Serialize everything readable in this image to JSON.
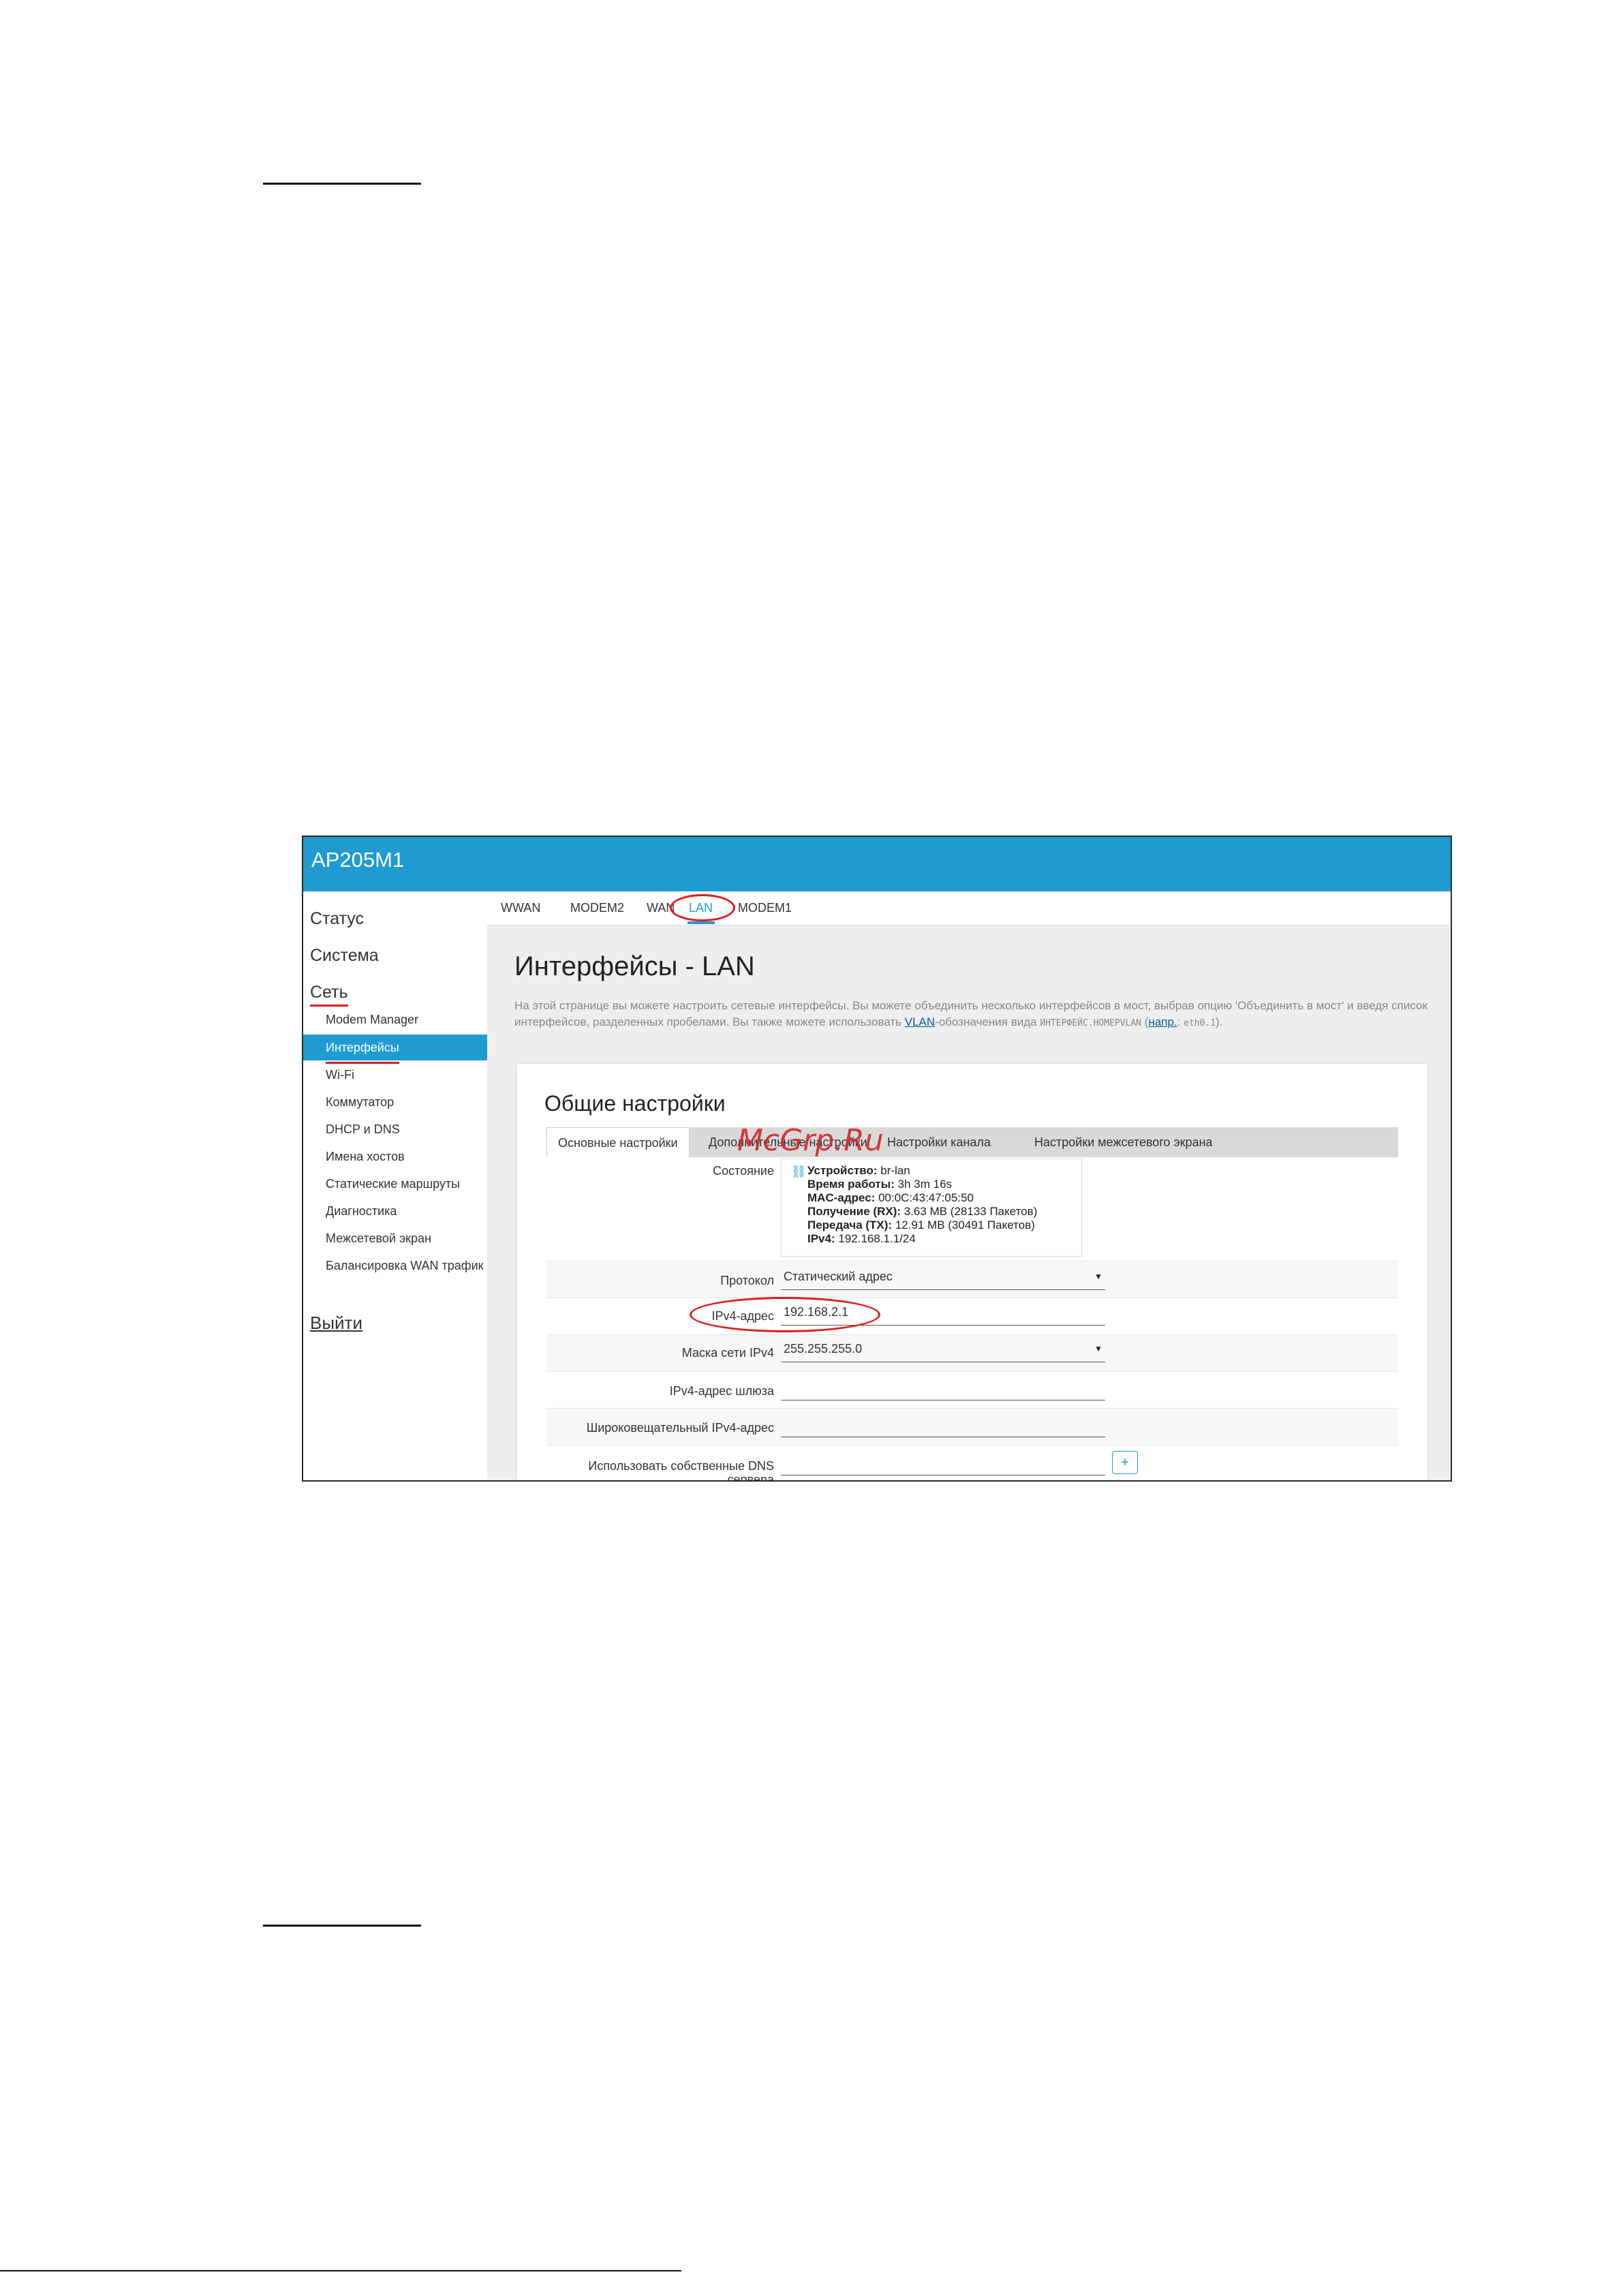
{
  "app": {
    "title": "AP205M1"
  },
  "sidebar": {
    "top_items": [
      {
        "label": "Статус"
      },
      {
        "label": "Система"
      },
      {
        "label": "Сеть"
      }
    ],
    "sub_items": [
      {
        "label": "Modem Manager"
      },
      {
        "label": "Интерфейсы"
      },
      {
        "label": "Wi-Fi"
      },
      {
        "label": "Коммутатор"
      },
      {
        "label": "DHCP и DNS"
      },
      {
        "label": "Имена хостов"
      },
      {
        "label": "Статические маршруты"
      },
      {
        "label": "Диагностика"
      },
      {
        "label": "Межсетевой экран"
      },
      {
        "label": "Балансировка WAN трафик"
      }
    ],
    "logout_label": "Выйти"
  },
  "interface_tabs": [
    {
      "label": "WWAN"
    },
    {
      "label": "MODEM2"
    },
    {
      "label": "WAN"
    },
    {
      "label": "LAN"
    },
    {
      "label": "MODEM1"
    }
  ],
  "main": {
    "title": "Интерфейсы - LAN",
    "desc_part1": "На этой странице вы можете настроить сетевые интерфейсы. Вы можете объединить несколько интерфейсов в мост, выбрав опцию 'Объединить в мост' и введя список интерфейсов, разделенных пробелами. Вы также можете использовать ",
    "desc_vlan": "VLAN",
    "desc_part2": "-обозначения вида ",
    "desc_code1": "ИНТЕРФЕЙС.НОМЕРVLAN",
    "desc_part3": " (",
    "desc_example": "напр.",
    "desc_part4": ": ",
    "desc_code2": "eth0.1",
    "desc_part5": ")."
  },
  "card": {
    "title": "Общие настройки",
    "tabs": [
      {
        "label": "Основные настройки"
      },
      {
        "label": "Дополнительные настройки"
      },
      {
        "label": "Настройки канала"
      },
      {
        "label": "Настройки межсетевого экрана"
      }
    ],
    "status_label": "Состояние",
    "status": {
      "device_key": "Устройство:",
      "device_val": " br-lan",
      "uptime_key": "Время работы:",
      "uptime_val": " 3h 3m 16s",
      "mac_key": "MAC-адрес:",
      "mac_val": " 00:0C:43:47:05:50",
      "rx_key": "Получение (RX):",
      "rx_val": " 3.63 MB (28133 Пакетов)",
      "tx_key": "Передача (TX):",
      "tx_val": " 12.91 MB (30491 Пакетов)",
      "ipv4_key": "IPv4:",
      "ipv4_val": " 192.168.1.1/24"
    },
    "fields": {
      "protocol_label": "Протокол",
      "protocol_value": "Статический адрес",
      "ipv4_label": "IPv4-адрес",
      "ipv4_value": "192.168.2.1",
      "mask_label": "Маска сети IPv4",
      "mask_value": "255.255.255.0",
      "gateway_label": "IPv4-адрес шлюза",
      "gateway_value": "",
      "broadcast_label": "Широковещательный IPv4-адрес",
      "broadcast_value": "",
      "dns_label": "Использовать собственные DNS сервера",
      "dns_value": ""
    },
    "plus_label": "+"
  },
  "watermark": "McGrp.Ru",
  "accent_color": "#1f9bd1",
  "highlight_color": "#e01b1b"
}
